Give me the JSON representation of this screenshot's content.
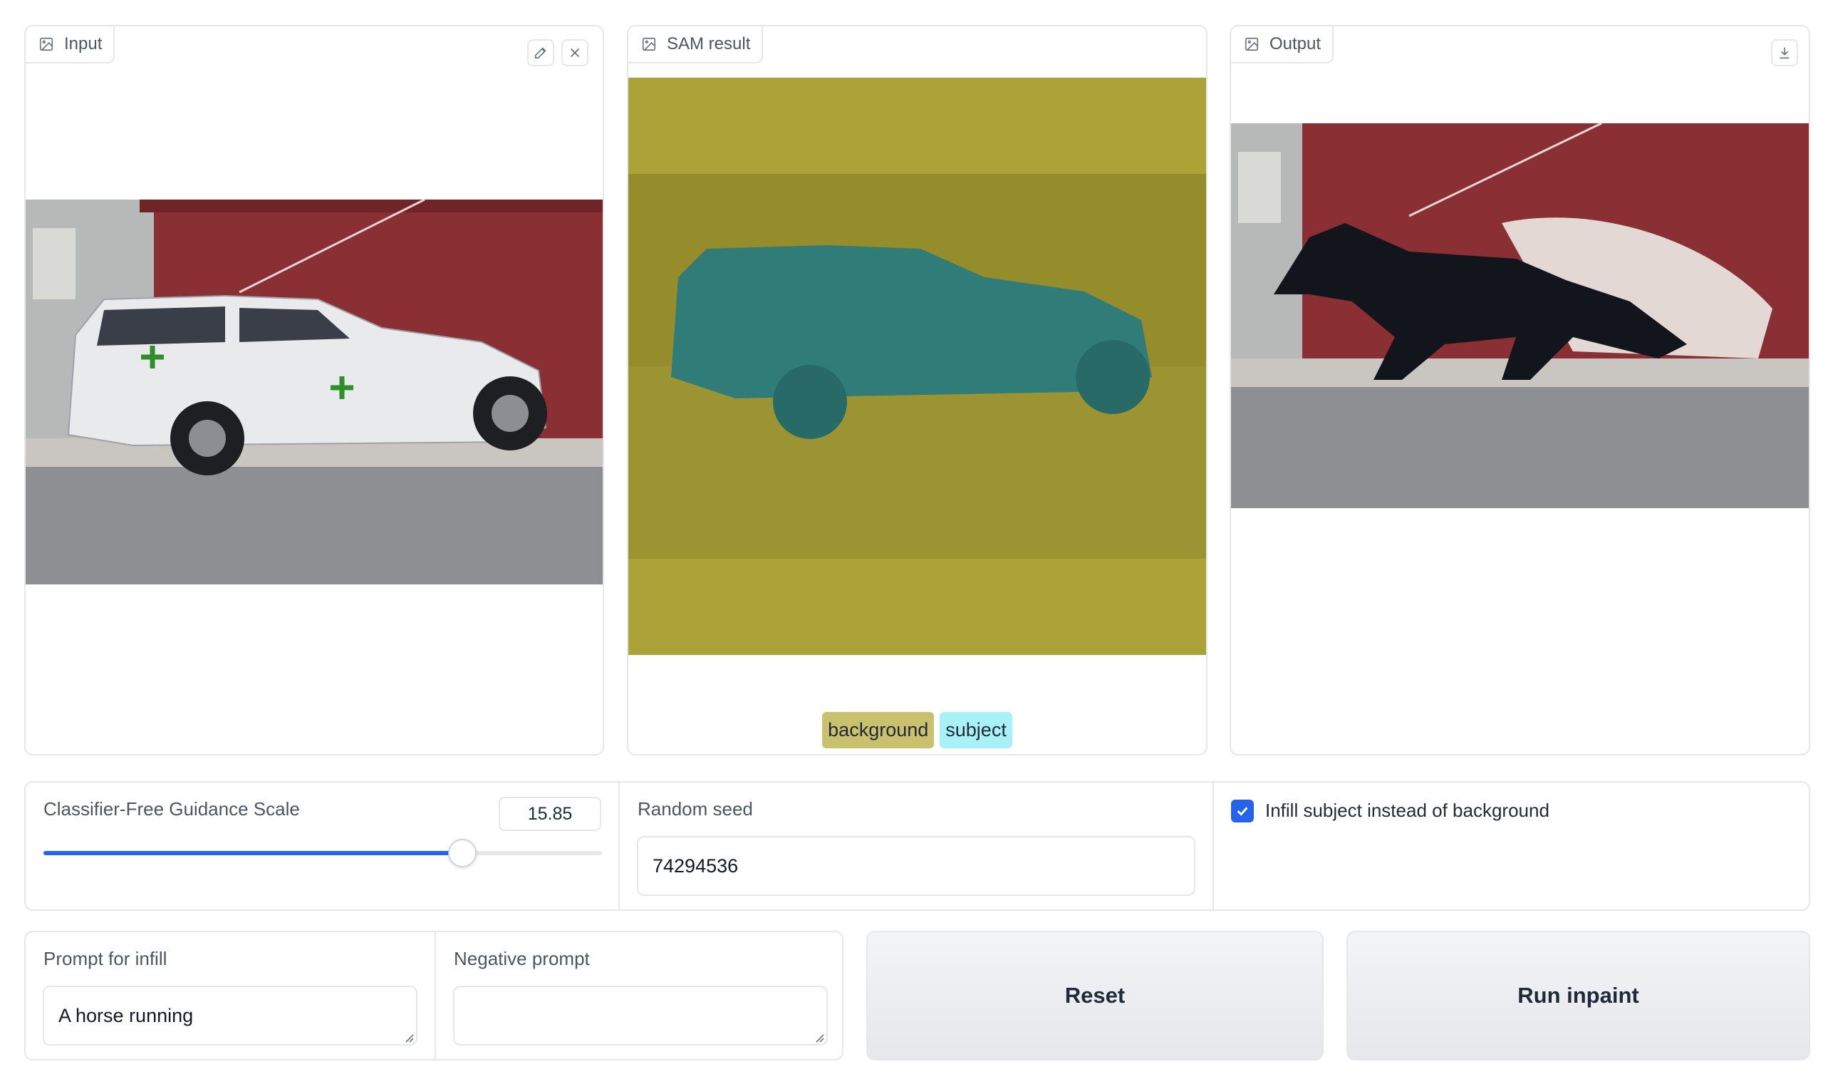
{
  "panels": {
    "input": {
      "label": "Input"
    },
    "sam": {
      "label": "SAM result",
      "legend": [
        "background",
        "subject"
      ]
    },
    "output": {
      "label": "Output"
    }
  },
  "colors": {
    "background_mask": "#aba337",
    "subject_mask": "#2f7c78",
    "accent": "#2563eb",
    "legend_background": "#c9c16e",
    "legend_subject": "#a8f1f7"
  },
  "controls": {
    "cfg": {
      "label": "Classifier-Free Guidance Scale",
      "value": "15.85",
      "fraction": 0.75
    },
    "seed": {
      "label": "Random seed",
      "value": "74294536"
    },
    "infill": {
      "label": "Infill subject instead of background",
      "checked": true
    }
  },
  "prompts": {
    "prompt": {
      "label": "Prompt for infill",
      "value": "A horse running"
    },
    "negative": {
      "label": "Negative prompt",
      "value": ""
    }
  },
  "buttons": {
    "reset": "Reset",
    "run": "Run inpaint"
  },
  "icons": [
    "image-icon",
    "edit-icon",
    "close-icon",
    "download-icon",
    "check-icon"
  ]
}
